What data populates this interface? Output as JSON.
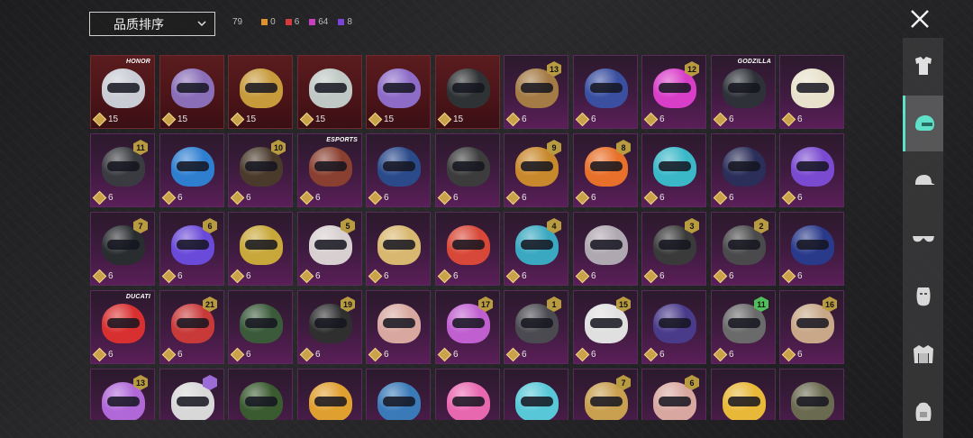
{
  "sort": {
    "label": "品质排序"
  },
  "counts": {
    "total": "79",
    "items": [
      {
        "color": "#e0922a",
        "value": "0"
      },
      {
        "color": "#d63a3a",
        "value": "6"
      },
      {
        "color": "#c640c0",
        "value": "64"
      },
      {
        "color": "#7a45d6",
        "value": "8"
      }
    ]
  },
  "icons": {
    "close": "close-icon",
    "dropdown": "chevron-down-icon",
    "coin": "coin-icon"
  },
  "sidebar": {
    "tabs": [
      {
        "name": "outfit-tab",
        "icon": "outfit-icon",
        "active": false
      },
      {
        "name": "helmet-tab",
        "icon": "helmet-icon",
        "active": true
      },
      {
        "name": "hat-tab",
        "icon": "cap-icon",
        "active": false
      },
      {
        "name": "glasses-tab",
        "icon": "glasses-icon",
        "active": false
      },
      {
        "name": "mask-tab",
        "icon": "mask-icon",
        "active": false
      },
      {
        "name": "jacket-tab",
        "icon": "jacket-icon",
        "active": false
      },
      {
        "name": "backpack-tab",
        "icon": "backpack-icon",
        "active": false
      }
    ]
  },
  "tiles": [
    {
      "cost": "15",
      "tier": "red",
      "color": "#c9ccd4",
      "tag": "HONOR"
    },
    {
      "cost": "15",
      "tier": "red",
      "color": "#8a6fb8"
    },
    {
      "cost": "15",
      "tier": "red",
      "color": "#c79a3c"
    },
    {
      "cost": "15",
      "tier": "red",
      "color": "#bfc8c4"
    },
    {
      "cost": "15",
      "tier": "red",
      "color": "#8d6cc8"
    },
    {
      "cost": "15",
      "tier": "red",
      "color": "#2f3234"
    },
    {
      "cost": "6",
      "tier": "purple",
      "color": "#a47a45",
      "level": "13"
    },
    {
      "cost": "6",
      "tier": "purple",
      "color": "#3a4fa0"
    },
    {
      "cost": "6",
      "tier": "purple",
      "color": "#d83ec8",
      "level": "12"
    },
    {
      "cost": "6",
      "tier": "purple",
      "color": "#2e3238",
      "tag": "GODZILLA"
    },
    {
      "cost": "6",
      "tier": "purple",
      "color": "#e8e2cc"
    },
    {
      "cost": "6",
      "tier": "purple",
      "color": "#3a3b40",
      "level": "11"
    },
    {
      "cost": "6",
      "tier": "purple",
      "color": "#2f7fd0"
    },
    {
      "cost": "6",
      "tier": "purple",
      "color": "#4a3a2c",
      "level": "10"
    },
    {
      "cost": "6",
      "tier": "purple",
      "color": "#8a4030",
      "tag": "ESPORTS"
    },
    {
      "cost": "6",
      "tier": "purple",
      "color": "#2a4a8a"
    },
    {
      "cost": "6",
      "tier": "purple",
      "color": "#3c3c3c"
    },
    {
      "cost": "6",
      "tier": "purple",
      "color": "#c8882c",
      "level": "9"
    },
    {
      "cost": "6",
      "tier": "purple",
      "color": "#e8702a",
      "level": "8"
    },
    {
      "cost": "6",
      "tier": "purple",
      "color": "#3ab8c8"
    },
    {
      "cost": "6",
      "tier": "purple",
      "color": "#2a2e58"
    },
    {
      "cost": "6",
      "tier": "purple",
      "color": "#7a4ad0"
    },
    {
      "cost": "6",
      "tier": "purple",
      "color": "#2a2d30",
      "level": "7"
    },
    {
      "cost": "6",
      "tier": "purple",
      "color": "#6a4ad8",
      "level": "6"
    },
    {
      "cost": "6",
      "tier": "purple",
      "color": "#c8a83a"
    },
    {
      "cost": "6",
      "tier": "purple",
      "color": "#d8d0d0",
      "level": "5"
    },
    {
      "cost": "6",
      "tier": "purple",
      "color": "#d8b870"
    },
    {
      "cost": "6",
      "tier": "purple",
      "color": "#d84838"
    },
    {
      "cost": "6",
      "tier": "purple",
      "color": "#3aa8c0",
      "level": "4"
    },
    {
      "cost": "6",
      "tier": "purple",
      "color": "#b0a8b0"
    },
    {
      "cost": "6",
      "tier": "purple",
      "color": "#3a3a3a",
      "level": "3"
    },
    {
      "cost": "6",
      "tier": "purple",
      "color": "#4a4a4c",
      "level": "2"
    },
    {
      "cost": "6",
      "tier": "purple",
      "color": "#2a3a8a"
    },
    {
      "cost": "6",
      "tier": "purple",
      "color": "#d83030",
      "tag": "DUCATI"
    },
    {
      "cost": "6",
      "tier": "purple",
      "color": "#c83a3a",
      "level": "21"
    },
    {
      "cost": "6",
      "tier": "purple",
      "color": "#3a5a3a"
    },
    {
      "cost": "6",
      "tier": "purple",
      "color": "#2f2f30",
      "level": "19"
    },
    {
      "cost": "6",
      "tier": "purple",
      "color": "#d8a8a0"
    },
    {
      "cost": "6",
      "tier": "purple",
      "color": "#c060d0",
      "level": "17"
    },
    {
      "cost": "6",
      "tier": "purple",
      "color": "#4a4a50",
      "level": "1"
    },
    {
      "cost": "6",
      "tier": "purple",
      "color": "#e0e0e0",
      "level": "15"
    },
    {
      "cost": "6",
      "tier": "purple",
      "color": "#4a3a8a"
    },
    {
      "cost": "6",
      "tier": "purple",
      "color": "#6a6a6a",
      "level": "11",
      "levelColor": "green"
    },
    {
      "cost": "6",
      "tier": "purple",
      "color": "#c8a888",
      "level": "16"
    },
    {
      "cost": "",
      "tier": "purple",
      "color": "#b068d8",
      "level": "13"
    },
    {
      "cost": "",
      "tier": "purple",
      "color": "#d8d8d8",
      "level": "",
      "levelColor": "purple"
    },
    {
      "cost": "",
      "tier": "purple",
      "color": "#3a5a30"
    },
    {
      "cost": "",
      "tier": "purple",
      "color": "#e0a030"
    },
    {
      "cost": "",
      "tier": "purple",
      "color": "#3a7ab8"
    },
    {
      "cost": "",
      "tier": "purple",
      "color": "#e868b0"
    },
    {
      "cost": "",
      "tier": "purple",
      "color": "#58c8d8"
    },
    {
      "cost": "",
      "tier": "purple",
      "color": "#c8a050",
      "level": "7"
    },
    {
      "cost": "",
      "tier": "purple",
      "color": "#d8a8a0",
      "level": "6"
    },
    {
      "cost": "",
      "tier": "purple",
      "color": "#e8b838"
    },
    {
      "cost": "",
      "tier": "purple",
      "color": "#6a6a50"
    }
  ]
}
